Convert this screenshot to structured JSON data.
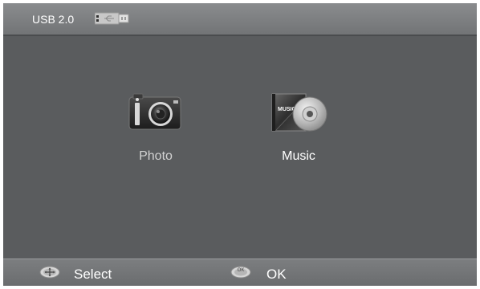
{
  "topbar": {
    "source_label": "USB 2.0",
    "source_icon": "usb-drive-icon"
  },
  "apps": [
    {
      "label": "Photo",
      "icon": "camera-icon"
    },
    {
      "label": "Music",
      "icon": "music-cd-icon"
    }
  ],
  "bottombar": {
    "select": {
      "icon": "dpad-icon",
      "label": "Select"
    },
    "ok": {
      "icon": "ok-button-icon",
      "label": "OK",
      "badge": "OK"
    }
  },
  "colors": {
    "background": "#5a5c5e",
    "bar": "#7c7e80",
    "text": "#ffffff"
  }
}
